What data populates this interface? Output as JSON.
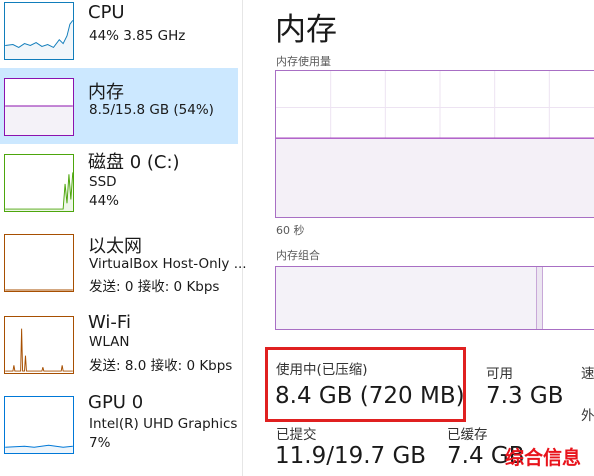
{
  "sidebar": {
    "items": [
      {
        "name": "CPU",
        "line1": "44% 3.85 GHz",
        "line2": ""
      },
      {
        "name": "内存",
        "line1": "8.5/15.8 GB (54%)",
        "line2": ""
      },
      {
        "name": "磁盘 0 (C:)",
        "line1": "SSD",
        "line2": "44%"
      },
      {
        "name": "以太网",
        "line1": "VirtualBox Host-Only ...",
        "line2": "发送: 0 接收: 0 Kbps"
      },
      {
        "name": "Wi-Fi",
        "line1": "WLAN",
        "line2": "发送: 8.0 接收: 0 Kbps"
      },
      {
        "name": "GPU 0",
        "line1": "Intel(R) UHD Graphics",
        "line2": "7%"
      }
    ]
  },
  "main": {
    "title": "内存",
    "graph_label": "内存使用量",
    "time_label": "60 秒",
    "composition_label": "内存组合",
    "memory_usage_fraction": 0.54,
    "stats": {
      "in_use_label": "使用中(已压缩)",
      "in_use_value": "8.4 GB (720 MB)",
      "available_label": "可用",
      "available_value": "7.3 GB",
      "speed_label": "速",
      "extra_label": "外",
      "committed_label": "已提交",
      "committed_value": "11.9/19.7 GB",
      "cached_label": "已缓存",
      "cached_value": "7.4 GB"
    }
  },
  "watermark": "综合信息",
  "colors": {
    "selected_bg": "#cce8ff",
    "cpu_line": "#117dbb",
    "memory_line": "#8b12ae",
    "disk_line": "#4da60c",
    "network_line": "#a74f01",
    "gpu_line": "#0078d7",
    "highlight": "#e02020"
  }
}
